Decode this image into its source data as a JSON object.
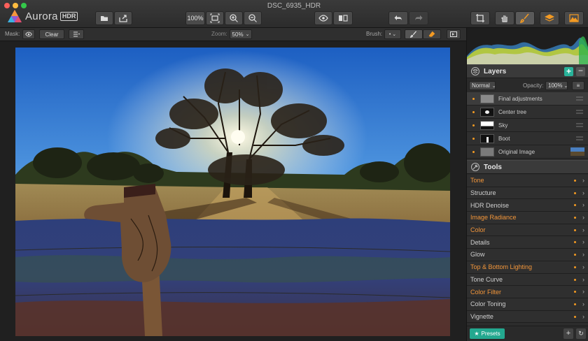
{
  "window": {
    "title": "DSC_6935_HDR"
  },
  "app": {
    "name": "Aurora",
    "badge": "HDR"
  },
  "toolbar": {
    "zoom_fit_label": "100%",
    "icons": [
      "open-file-icon",
      "share-icon",
      "fit-screen-icon",
      "zoom-in-icon",
      "zoom-out-icon",
      "eye-preview-icon",
      "compare-icon",
      "undo-icon",
      "redo-icon",
      "crop-icon",
      "hand-icon",
      "brush-icon",
      "layers-icon",
      "aurora-mode-icon"
    ]
  },
  "options": {
    "mask_label": "Mask:",
    "clear_label": "Clear",
    "zoom_label": "Zoom:",
    "zoom_value": "50%",
    "brush_label": "Brush:"
  },
  "layers": {
    "title": "Layers",
    "blend_mode": "Normal",
    "opacity_label": "Opacity:",
    "opacity_value": "100%",
    "items": [
      {
        "name": "Final adjustments"
      },
      {
        "name": "Center tree"
      },
      {
        "name": "Sky"
      },
      {
        "name": "Boot"
      },
      {
        "name": "Original Image"
      }
    ]
  },
  "tools": {
    "title": "Tools",
    "items": [
      {
        "label": "Tone",
        "active": true
      },
      {
        "label": "Structure",
        "active": false
      },
      {
        "label": "HDR Denoise",
        "active": false
      },
      {
        "label": "Image Radiance",
        "active": true
      },
      {
        "label": "Color",
        "active": true
      },
      {
        "label": "Details",
        "active": false
      },
      {
        "label": "Glow",
        "active": false
      },
      {
        "label": "Top & Bottom Lighting",
        "active": true
      },
      {
        "label": "Tone Curve",
        "active": false
      },
      {
        "label": "Color Filter",
        "active": true
      },
      {
        "label": "Color Toning",
        "active": false
      },
      {
        "label": "Vignette",
        "active": false
      }
    ]
  },
  "footer": {
    "presets_label": "Presets"
  },
  "colors": {
    "accent": "#f39a23",
    "teal": "#29b39a",
    "active_tool_text": "#f3963a",
    "inactive_tool_text": "#cfcfcf"
  }
}
